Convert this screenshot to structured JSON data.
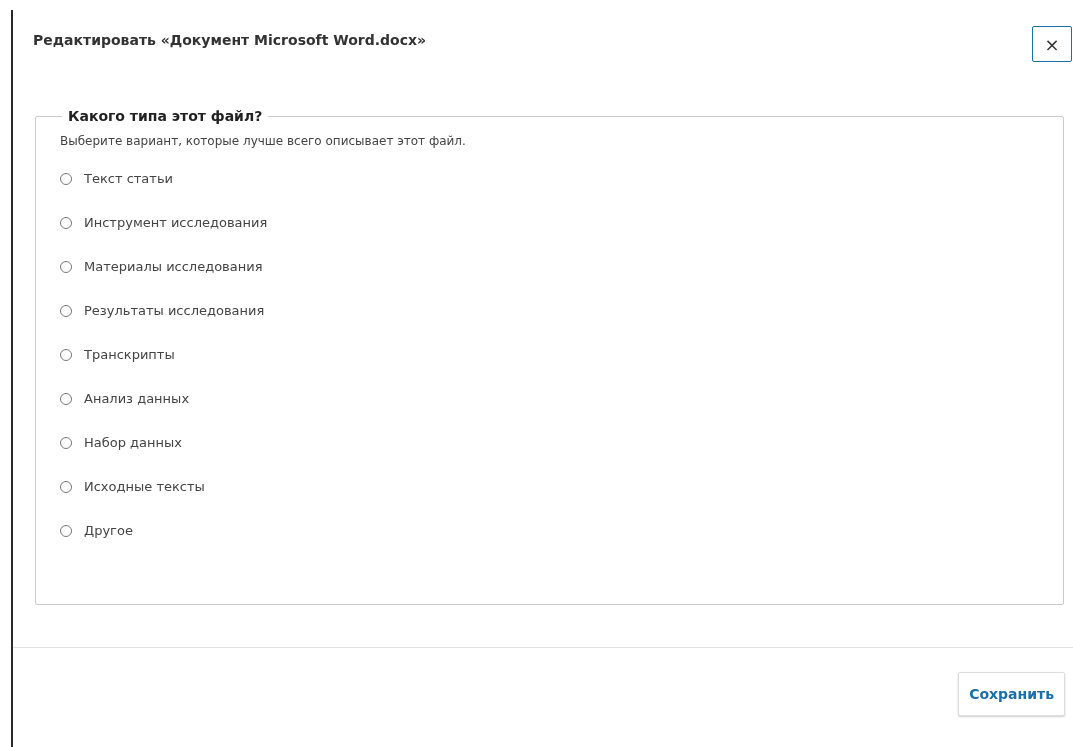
{
  "dialog": {
    "title": "Редактировать «Документ Microsoft Word.docx»",
    "close_label": "×"
  },
  "fieldset": {
    "legend": "Какого типа этот файл?",
    "description": "Выберите вариант, которые лучше всего описывает этот файл.",
    "options": [
      {
        "label": "Текст статьи",
        "selected": false
      },
      {
        "label": "Инструмент исследования",
        "selected": false
      },
      {
        "label": "Материалы исследования",
        "selected": false
      },
      {
        "label": "Результаты исследования",
        "selected": false
      },
      {
        "label": "Транскрипты",
        "selected": false
      },
      {
        "label": "Анализ данных",
        "selected": false
      },
      {
        "label": "Набор данных",
        "selected": false
      },
      {
        "label": "Исходные тексты",
        "selected": false
      },
      {
        "label": "Другое",
        "selected": false
      }
    ]
  },
  "footer": {
    "save_label": "Сохранить"
  }
}
